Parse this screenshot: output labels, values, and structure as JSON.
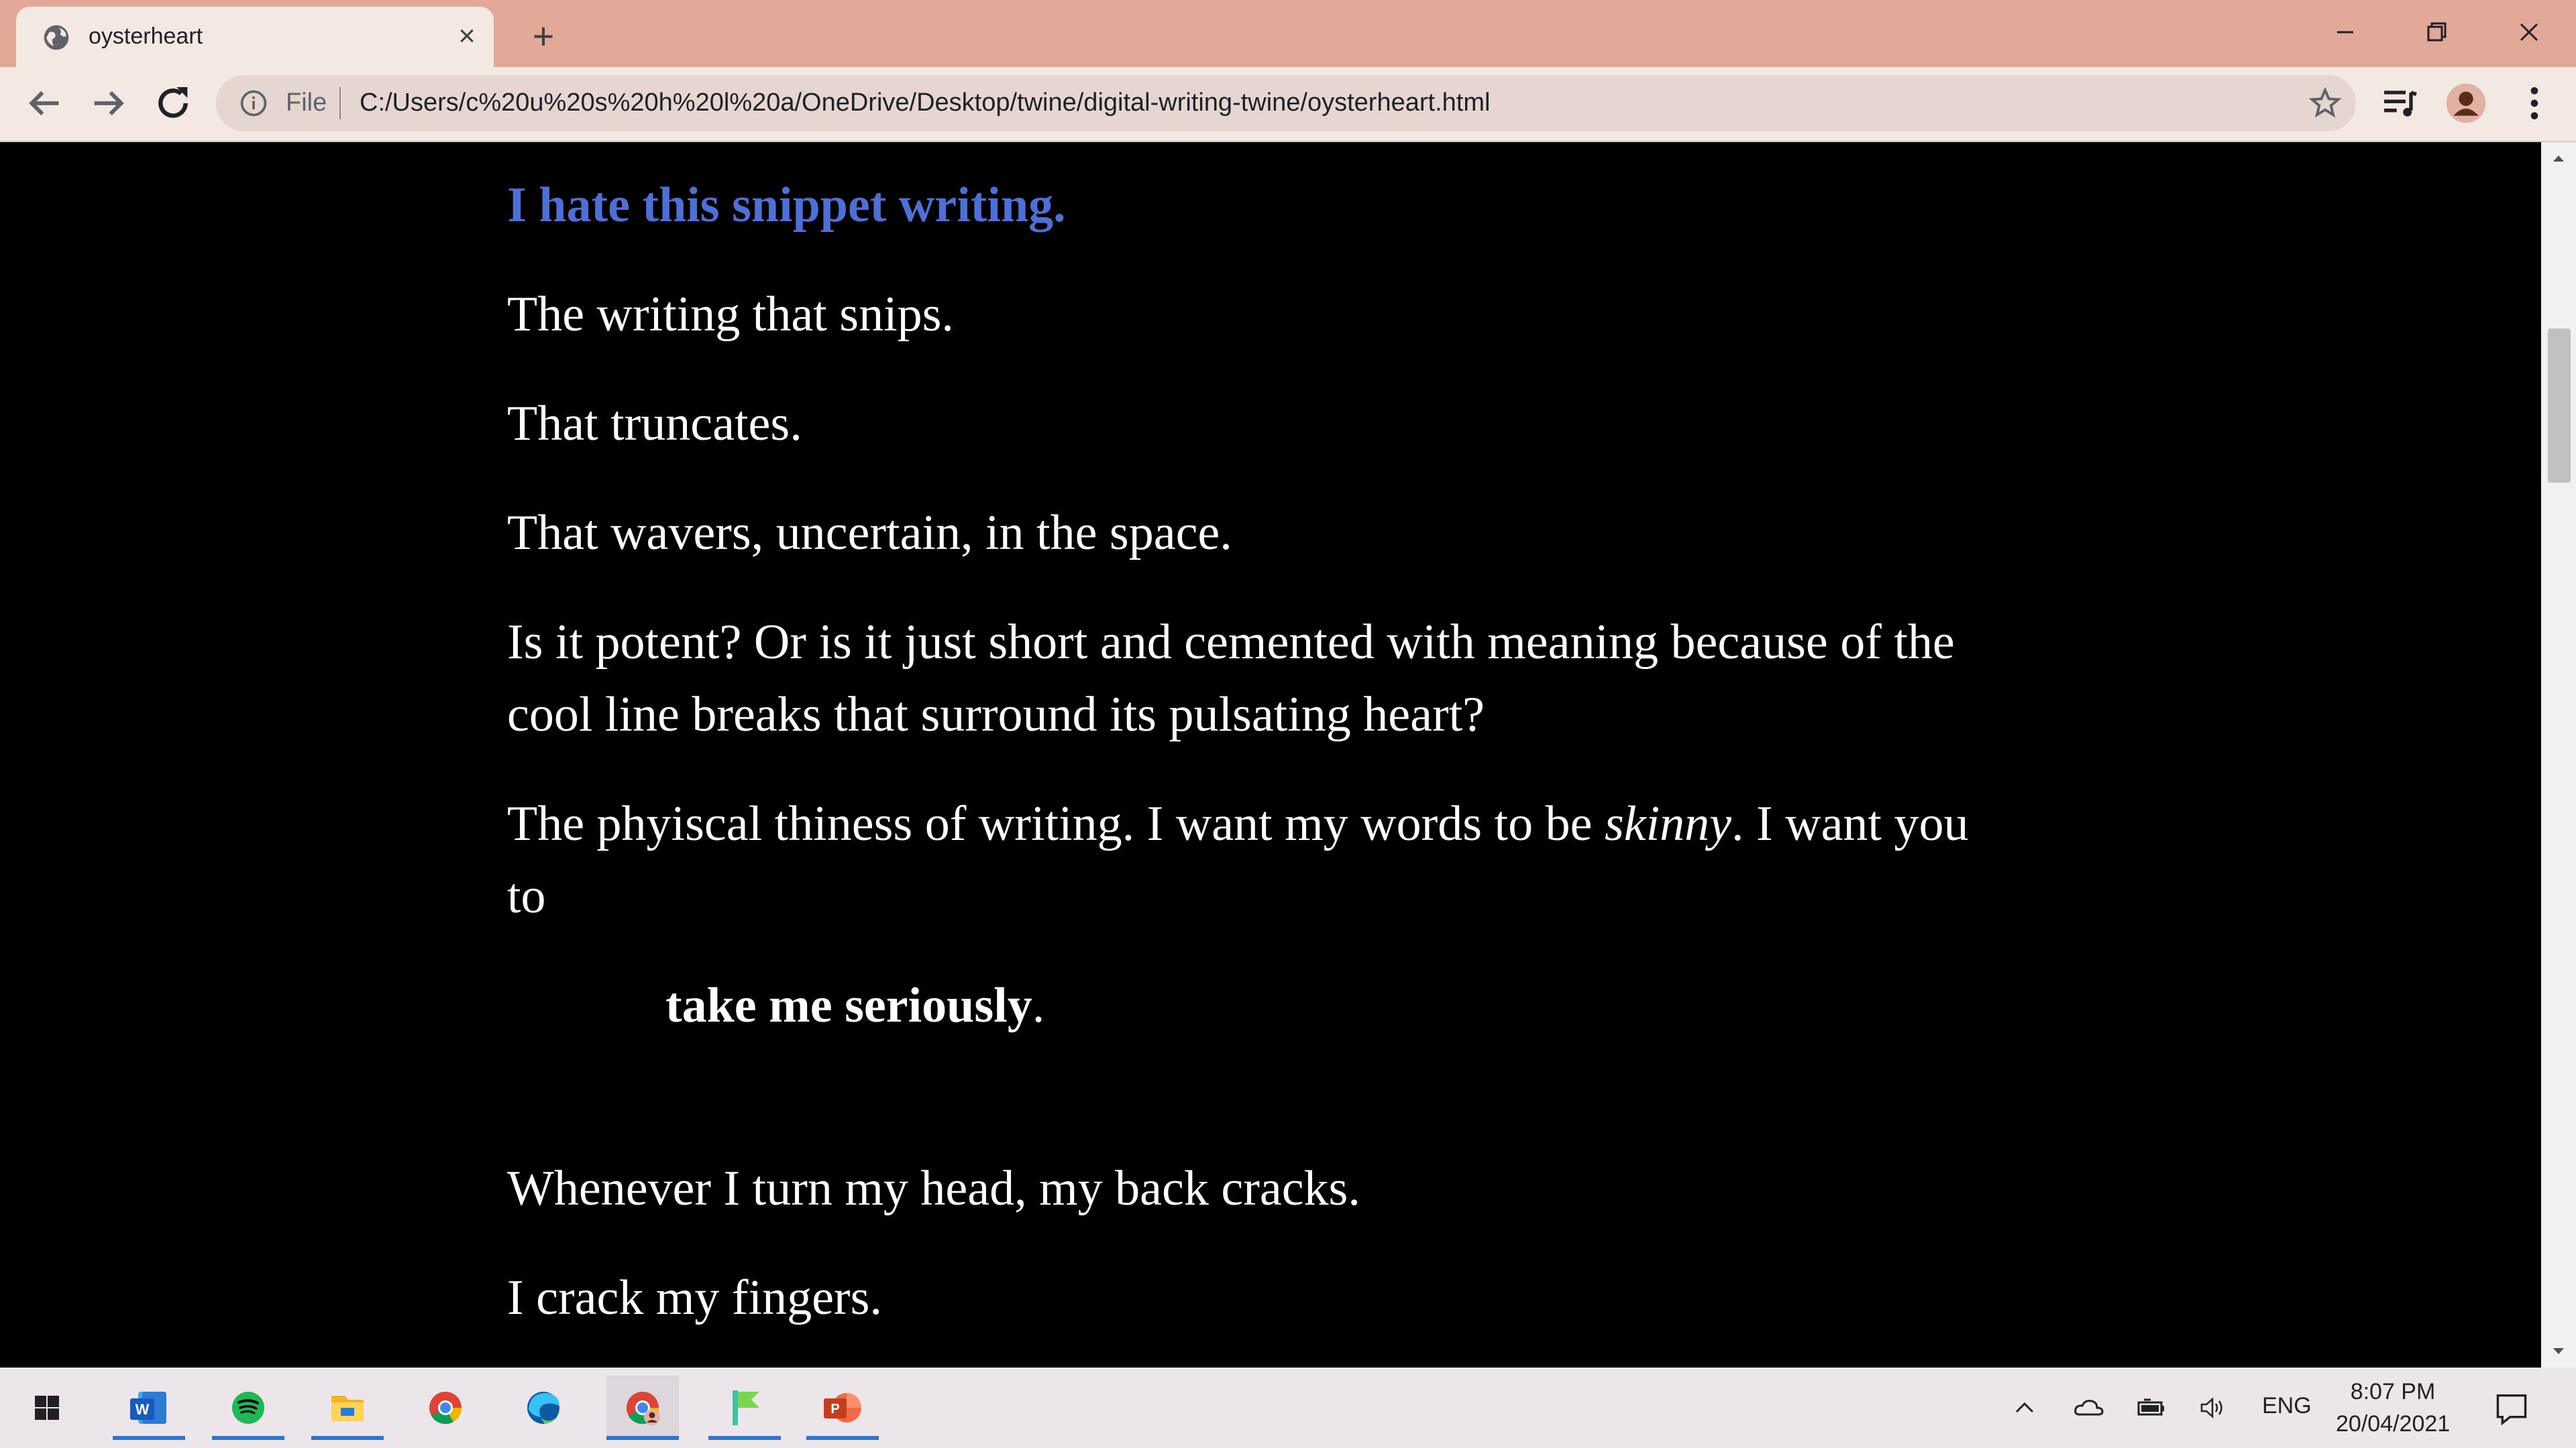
{
  "browser": {
    "tab_title": "oysterheart",
    "address_prefix": "File",
    "url": "C:/Users/c%20u%20s%20h%20l%20a/OneDrive/Desktop/twine/digital-writing-twine/oysterheart.html"
  },
  "page": {
    "heading": "I hate this snippet writing.",
    "paragraphs": [
      "The writing that snips.",
      "That truncates.",
      "That wavers, uncertain, in the space.",
      "Is it potent? Or is it just short and cemented with meaning because of the cool line breaks that surround its pulsating heart?"
    ],
    "p5_before": "The phyiscal thiness of writing. I want my words to be ",
    "p5_italic": "skinny",
    "p5_after": ". I want you to",
    "emphasis_bold": "take me seriously",
    "emphasis_after": ".",
    "after": [
      "Whenever I turn my head, my back cracks.",
      "I crack my fingers."
    ]
  },
  "taskbar": {
    "apps": [
      "word-icon",
      "spotify-icon",
      "file-explorer-icon",
      "chrome-icon",
      "edge-icon",
      "chrome-profile-icon",
      "app-flag-icon",
      "powerpoint-icon"
    ],
    "language": "ENG",
    "time": "8:07 PM",
    "date": "20/04/2021"
  },
  "colors": {
    "tabbar": "#e3a998",
    "toolbar": "#f4e8e3",
    "heading": "#4d6fd6",
    "page_bg": "#000000",
    "text": "#ffffff"
  }
}
